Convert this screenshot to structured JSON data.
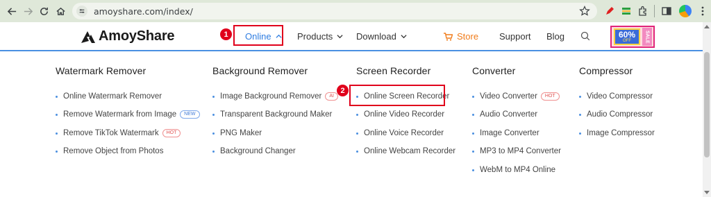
{
  "browser": {
    "url": "amoyshare.com/index/"
  },
  "header": {
    "logo_text": "AmoyShare",
    "nav": [
      {
        "label": "Online",
        "active": true
      },
      {
        "label": "Products"
      },
      {
        "label": "Download"
      },
      {
        "label": "Store"
      },
      {
        "label": "Support"
      },
      {
        "label": "Blog"
      }
    ],
    "sale": {
      "percent": "60%",
      "off": "OFF",
      "side": "SALE"
    }
  },
  "annotations": {
    "step1": "1",
    "step2": "2"
  },
  "menu": {
    "columns": [
      {
        "title": "Watermark Remover",
        "items": [
          {
            "label": "Online Watermark Remover",
            "tag": ""
          },
          {
            "label": "Remove Watermark from Image",
            "tag": "NEW"
          },
          {
            "label": "Remove TikTok Watermark",
            "tag": "HOT"
          },
          {
            "label": "Remove Object from Photos",
            "tag": ""
          }
        ]
      },
      {
        "title": "Background Remover",
        "items": [
          {
            "label": "Image Background Remover",
            "tag": "AI"
          },
          {
            "label": "Transparent Background Maker",
            "tag": ""
          },
          {
            "label": "PNG Maker",
            "tag": ""
          },
          {
            "label": "Background Changer",
            "tag": ""
          }
        ]
      },
      {
        "title": "Screen Recorder",
        "items": [
          {
            "label": "Online Screen Recorder",
            "tag": ""
          },
          {
            "label": "Online Video Recorder",
            "tag": ""
          },
          {
            "label": "Online Voice Recorder",
            "tag": ""
          },
          {
            "label": "Online Webcam Recorder",
            "tag": ""
          }
        ]
      },
      {
        "title": "Converter",
        "items": [
          {
            "label": "Video Converter",
            "tag": "HOT"
          },
          {
            "label": "Audio Converter",
            "tag": ""
          },
          {
            "label": "Image Converter",
            "tag": ""
          },
          {
            "label": "MP3 to MP4 Converter",
            "tag": ""
          },
          {
            "label": "WebM to MP4 Online",
            "tag": ""
          }
        ]
      },
      {
        "title": "Compressor",
        "items": [
          {
            "label": "Video Compressor",
            "tag": ""
          },
          {
            "label": "Audio Compressor",
            "tag": ""
          },
          {
            "label": "Image Compressor",
            "tag": ""
          }
        ]
      }
    ]
  },
  "colors": {
    "accent": "#4a90e2",
    "highlight": "#e0001b",
    "store": "#f07c1a"
  }
}
